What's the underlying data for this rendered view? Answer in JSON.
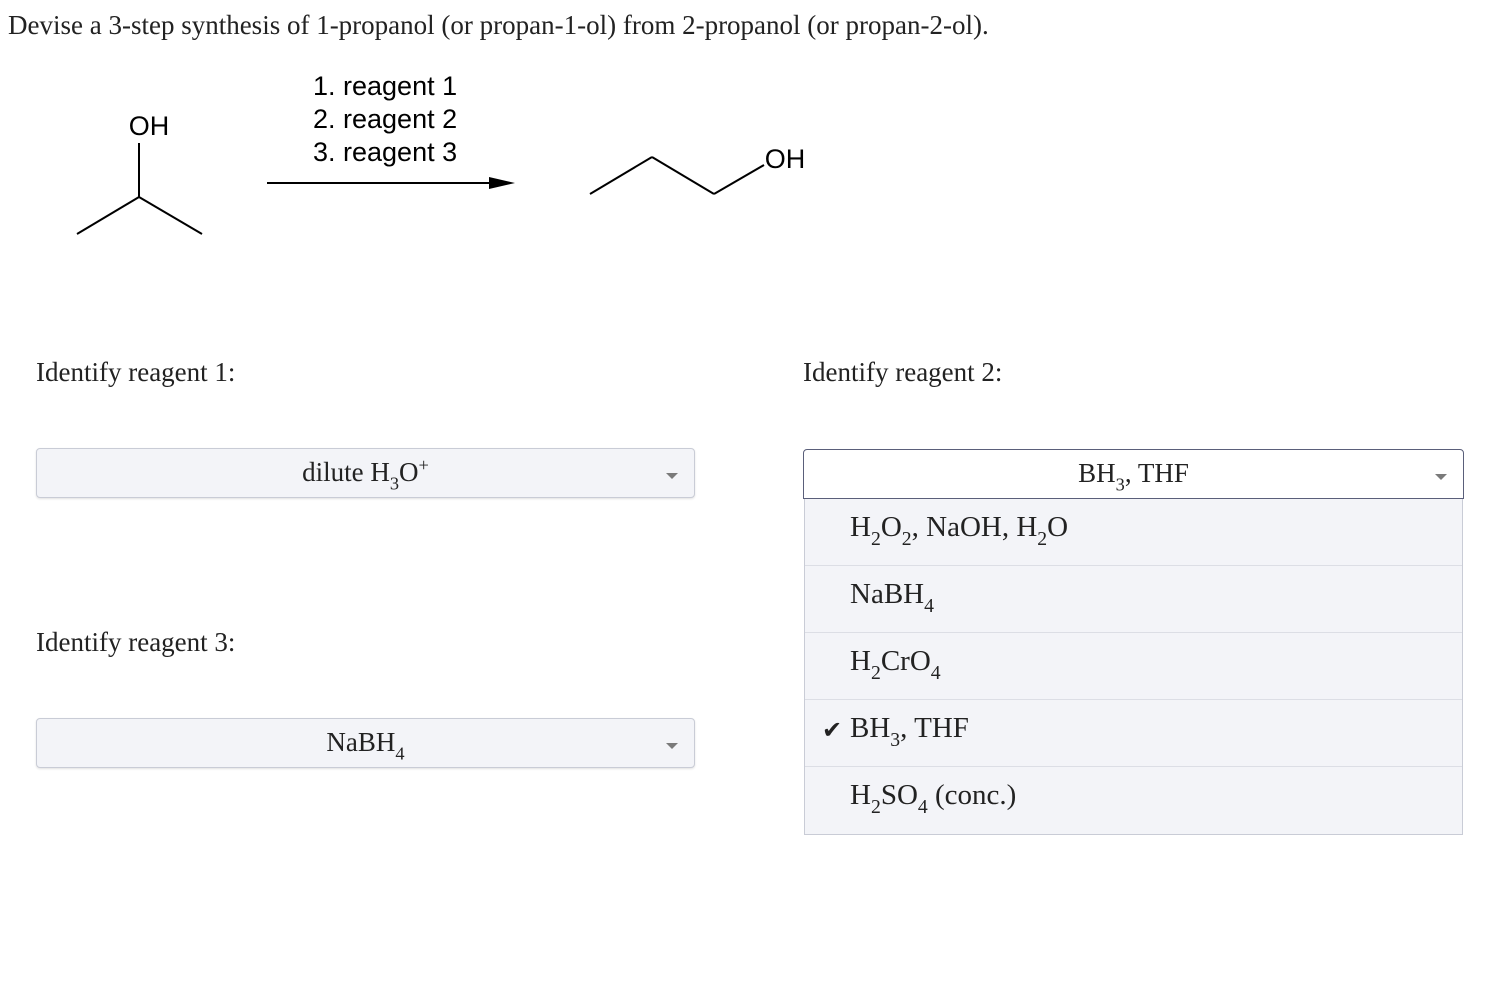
{
  "question": "Devise a 3-step synthesis of 1-propanol (or propan-1-ol) from 2-propanol (or propan-2-ol).",
  "scheme": {
    "reactant_label": "OH",
    "product_label": "OH",
    "steps": [
      "1. reagent 1",
      "2. reagent 2",
      "3. reagent 3"
    ]
  },
  "reagent1": {
    "label": "Identify reagent 1:",
    "selected": [
      "dilute H",
      "3",
      "O",
      "+"
    ]
  },
  "reagent2": {
    "label": "Identify reagent 2:",
    "selected": [
      "BH",
      "3",
      ", THF"
    ]
  },
  "reagent3": {
    "label": "Identify reagent 3:",
    "selected": [
      "NaBH",
      "4"
    ]
  },
  "dropdown_options": [
    {
      "parts": [
        "H",
        "2",
        "O",
        "2",
        ", NaOH, H",
        "2",
        "O"
      ],
      "checked": false
    },
    {
      "parts": [
        "NaBH",
        "4"
      ],
      "checked": false
    },
    {
      "parts": [
        "H",
        "2",
        "CrO",
        "4"
      ],
      "checked": false
    },
    {
      "parts": [
        "BH",
        "3",
        ", THF"
      ],
      "checked": true
    },
    {
      "parts": [
        "H",
        "2",
        "SO",
        "4",
        " (conc.)"
      ],
      "checked": false
    }
  ],
  "check_glyph": "✔",
  "icons": {
    "check": "checkmark-icon",
    "caret": "chevron-down-icon"
  }
}
